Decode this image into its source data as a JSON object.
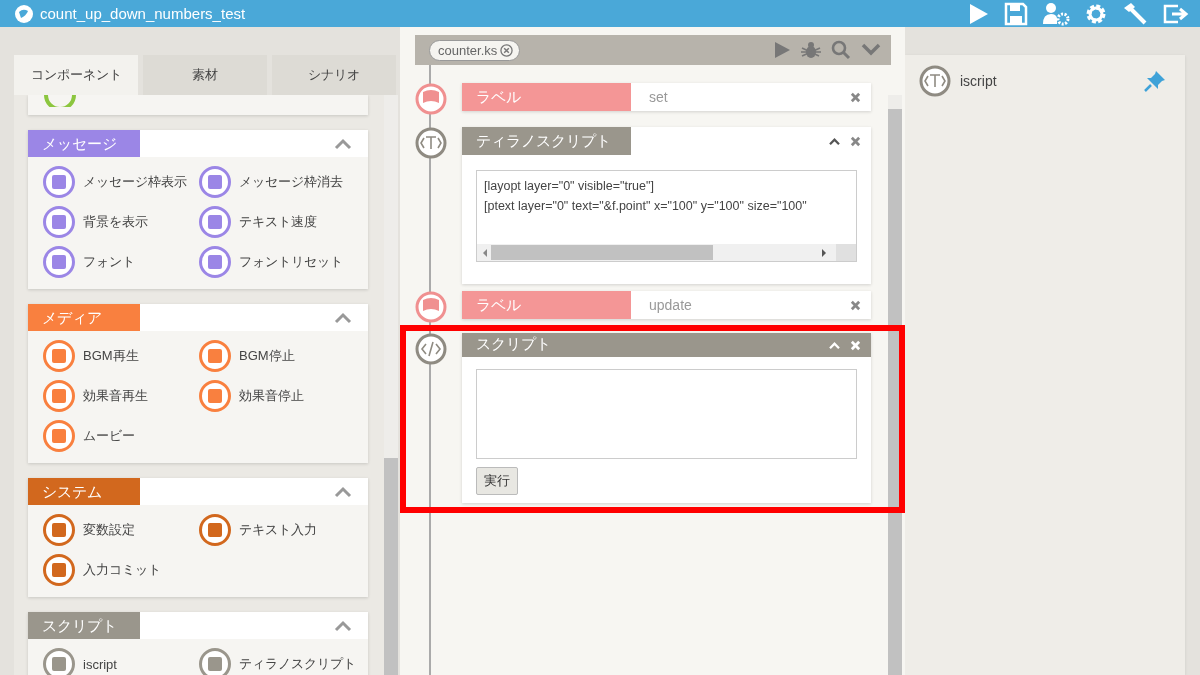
{
  "window": {
    "title": "count_up_down_numbers_test"
  },
  "tabs": [
    {
      "label": "コンポーネント",
      "selected": true
    },
    {
      "label": "素材",
      "selected": false
    },
    {
      "label": "シナリオ",
      "selected": false
    }
  ],
  "sections": [
    {
      "title": "メッセージ",
      "color": "#9b86e6",
      "items": [
        {
          "label": "メッセージ枠表示"
        },
        {
          "label": "メッセージ枠消去"
        },
        {
          "label": "背景を表示"
        },
        {
          "label": "テキスト速度"
        },
        {
          "label": "フォント"
        },
        {
          "label": "フォントリセット"
        }
      ]
    },
    {
      "title": "メディア",
      "color": "#f9803f",
      "items": [
        {
          "label": "BGM再生"
        },
        {
          "label": "BGM停止"
        },
        {
          "label": "効果音再生"
        },
        {
          "label": "効果音停止"
        },
        {
          "label": "ムービー"
        }
      ]
    },
    {
      "title": "システム",
      "color": "#d2681e",
      "items": [
        {
          "label": "変数設定"
        },
        {
          "label": "テキスト入力"
        },
        {
          "label": "入力コミット"
        }
      ]
    },
    {
      "title": "スクリプト",
      "color": "#9a968c",
      "items": [
        {
          "label": "iscript"
        },
        {
          "label": "ティラノスクリプト"
        }
      ]
    }
  ],
  "file_tab": {
    "label": "counter.ks"
  },
  "blocks": [
    {
      "kind": "label",
      "title": "ラベル",
      "value": "set"
    },
    {
      "kind": "tyrano",
      "title": "ティラノスクリプト",
      "lines": [
        "[layopt layer=\"0\" visible=\"true\"]",
        "[ptext layer=\"0\" text=\"&f.point\" x=\"100\" y=\"100\" size=\"100\""
      ]
    },
    {
      "kind": "label",
      "title": "ラベル",
      "value": "update"
    },
    {
      "kind": "script",
      "title": "スクリプト",
      "button": "実行"
    }
  ],
  "right_panel": {
    "item": "iscript"
  }
}
